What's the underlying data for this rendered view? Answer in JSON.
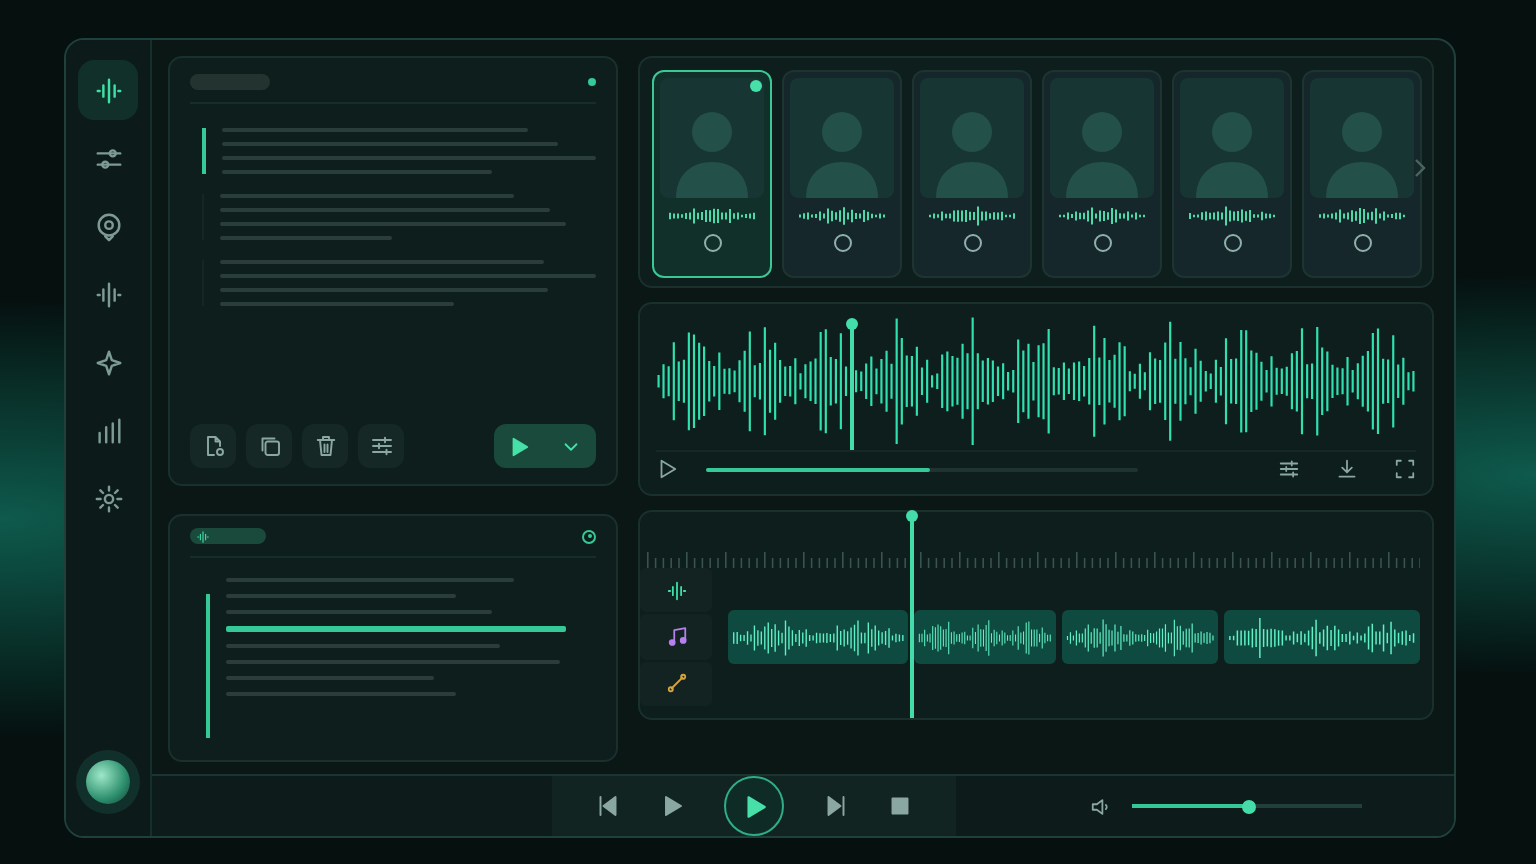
{
  "sidebar": {
    "items": [
      {
        "selected": true
      },
      {
        "selected": false
      },
      {
        "selected": false
      },
      {
        "selected": false
      },
      {
        "selected": false
      },
      {
        "selected": false
      },
      {
        "selected": false
      }
    ]
  },
  "script_panel": {
    "paragraphs": [
      {
        "selected": true
      },
      {
        "selected": false
      },
      {
        "selected": false
      }
    ]
  },
  "voices": [
    {
      "selected": true
    },
    {
      "selected": false
    },
    {
      "selected": false
    },
    {
      "selected": false
    },
    {
      "selected": false
    },
    {
      "selected": false
    }
  ],
  "preview": {
    "playhead": {
      "level": 0.26
    },
    "progress": {
      "level": 0.52
    }
  },
  "timeline": {
    "playhead": {
      "level": 0.27
    }
  },
  "transport": {
    "volume": {
      "level": 0.5
    }
  }
}
